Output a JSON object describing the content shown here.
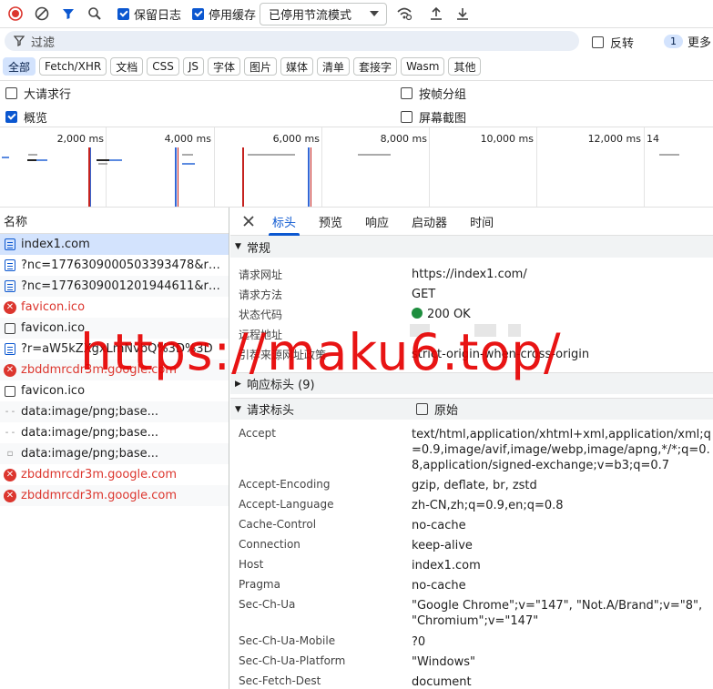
{
  "toolbar": {
    "preserve_log": "保留日志",
    "disable_cache": "停用缓存",
    "throttle": "已停用节流模式"
  },
  "filter": {
    "placeholder": "过滤",
    "invert": "反转",
    "issues_count": "1",
    "more": "更多"
  },
  "types": [
    "全部",
    "Fetch/XHR",
    "文档",
    "CSS",
    "JS",
    "字体",
    "图片",
    "媒体",
    "清单",
    "套接字",
    "Wasm",
    "其他"
  ],
  "options": {
    "big_rows": "大请求行",
    "group_by_frame": "按帧分组",
    "overview": "概览",
    "screenshots": "屏幕截图"
  },
  "overview_ticks": [
    "2,000 ms",
    "4,000 ms",
    "6,000 ms",
    "8,000 ms",
    "10,000 ms",
    "12,000 ms",
    "14"
  ],
  "list": {
    "header": "名称",
    "items": [
      {
        "icon": "doc",
        "name": "index1.com",
        "selected": true
      },
      {
        "icon": "doc",
        "name": "?nc=1776309000503393478&r=a..."
      },
      {
        "icon": "doc",
        "name": "?nc=1776309001201944611&r=a..."
      },
      {
        "icon": "err",
        "name": "favicon.ico"
      },
      {
        "icon": "box",
        "name": "favicon.ico"
      },
      {
        "icon": "doc",
        "name": "?r=aW5kZXgxLmNvbQ%3D%3D"
      },
      {
        "icon": "err",
        "name": "zbddmrcdr3m.google.com"
      },
      {
        "icon": "box",
        "name": "favicon.ico"
      },
      {
        "icon": "dash",
        "name": "data:image/png;base..."
      },
      {
        "icon": "dash",
        "name": "data:image/png;base..."
      },
      {
        "icon": "file",
        "name": "data:image/png;base..."
      },
      {
        "icon": "err",
        "name": "zbddmrcdr3m.google.com"
      },
      {
        "icon": "err",
        "name": "zbddmrcdr3m.google.com"
      }
    ]
  },
  "tabs": [
    "标头",
    "预览",
    "响应",
    "启动器",
    "时间"
  ],
  "general": {
    "title": "常规",
    "rows": [
      {
        "k": "请求网址",
        "v": "https://index1.com/"
      },
      {
        "k": "请求方法",
        "v": "GET"
      },
      {
        "k": "状态代码",
        "v": "200 OK"
      },
      {
        "k": "远程地址",
        "v": ""
      },
      {
        "k": "引荐来源网址政策",
        "v": "strict-origin-when-cross-origin"
      }
    ]
  },
  "response_headers": {
    "title": "响应标头 (9)"
  },
  "request_headers": {
    "title": "请求标头",
    "raw": "原始",
    "rows": [
      {
        "k": "Accept",
        "v": "text/html,application/xhtml+xml,application/xml;q=0.9,image/avif,image/webp,image/apng,*/*;q=0.8,application/signed-exchange;v=b3;q=0.7"
      },
      {
        "k": "Accept-Encoding",
        "v": "gzip, deflate, br, zstd"
      },
      {
        "k": "Accept-Language",
        "v": "zh-CN,zh;q=0.9,en;q=0.8"
      },
      {
        "k": "Cache-Control",
        "v": "no-cache"
      },
      {
        "k": "Connection",
        "v": "keep-alive"
      },
      {
        "k": "Host",
        "v": "index1.com"
      },
      {
        "k": "Pragma",
        "v": "no-cache"
      },
      {
        "k": "Sec-Ch-Ua",
        "v": "\"Google Chrome\";v=\"147\", \"Not.A/Brand\";v=\"8\", \"Chromium\";v=\"147\""
      },
      {
        "k": "Sec-Ch-Ua-Mobile",
        "v": "?0"
      },
      {
        "k": "Sec-Ch-Ua-Platform",
        "v": "\"Windows\""
      },
      {
        "k": "Sec-Fetch-Dest",
        "v": "document"
      }
    ]
  },
  "watermark": "https://maku6.top/",
  "colors": {
    "accent": "#0b57d0",
    "error": "#dc362e",
    "ok": "#1e8e3e",
    "watermark": "#e60000"
  }
}
